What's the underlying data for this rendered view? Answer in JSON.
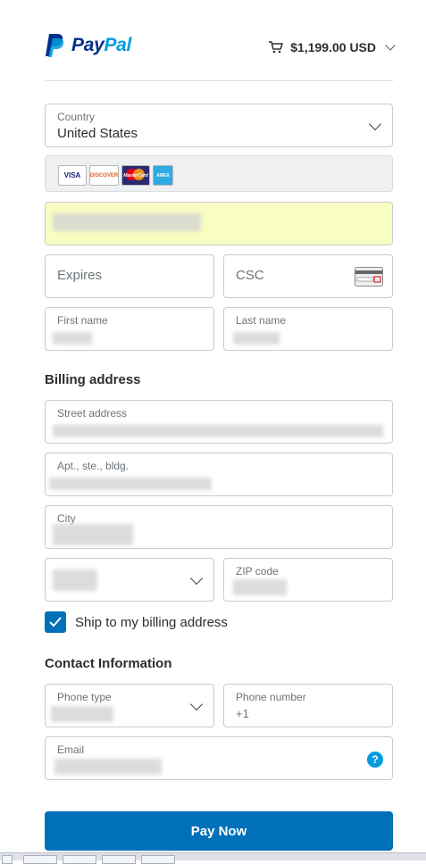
{
  "brand": {
    "name_part1": "Pay",
    "name_part2": "Pal"
  },
  "cart": {
    "amount": "$1,199.00 USD"
  },
  "form": {
    "country": {
      "label": "Country",
      "value": "United States"
    },
    "card_number": {
      "value": ""
    },
    "expires": {
      "placeholder": "Expires"
    },
    "csc": {
      "placeholder": "CSC"
    },
    "first_name": {
      "label": "First name"
    },
    "last_name": {
      "label": "Last name"
    },
    "billing_title": "Billing address",
    "street": {
      "label": "Street address"
    },
    "apt": {
      "label": "Apt., ste., bldg."
    },
    "city": {
      "label": "City"
    },
    "zip": {
      "label": "ZIP code"
    },
    "ship_label": "Ship to my billing address",
    "ship_checked": true,
    "contact_title": "Contact Information",
    "phone_type": {
      "label": "Phone type"
    },
    "phone_number": {
      "label": "Phone number",
      "value": "+1"
    },
    "email": {
      "label": "Email"
    },
    "pay_label": "Pay Now"
  },
  "card_logos": [
    "VISA",
    "DISCOVER",
    "MasterCard",
    "AMEX"
  ],
  "colors": {
    "accent": "#0070ba",
    "brand_dark": "#003087",
    "brand_light": "#009cde",
    "card_field_bg": "#f8fdc2"
  }
}
